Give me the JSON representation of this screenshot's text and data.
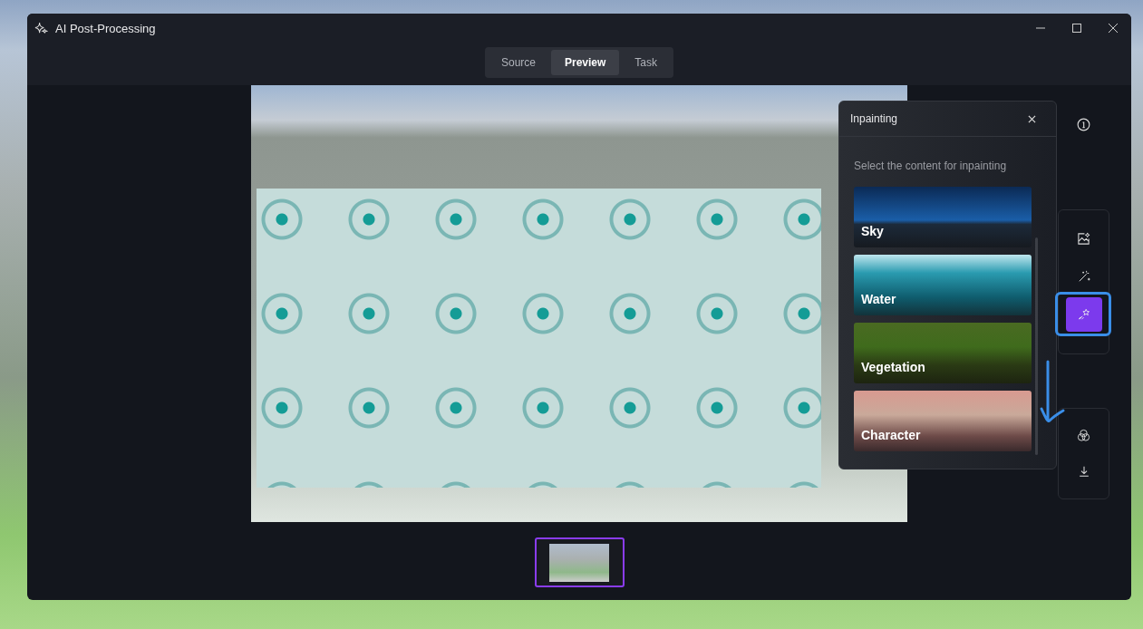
{
  "window": {
    "title": "AI Post-Processing"
  },
  "tabs": [
    {
      "label": "Source",
      "selected": false
    },
    {
      "label": "Preview",
      "selected": true
    },
    {
      "label": "Task",
      "selected": false
    }
  ],
  "inpainting_panel": {
    "title": "Inpainting",
    "instruction": "Select the content for inpainting",
    "options": [
      {
        "label": "Sky",
        "kind": "sky"
      },
      {
        "label": "Water",
        "kind": "water"
      },
      {
        "label": "Vegetation",
        "kind": "vegetation"
      },
      {
        "label": "Character",
        "kind": "character"
      }
    ]
  },
  "tool_groups": [
    [
      {
        "kind": "enhance",
        "selected": false
      },
      {
        "kind": "wand",
        "selected": false
      },
      {
        "kind": "inpaint",
        "selected": true
      }
    ],
    [
      {
        "kind": "color",
        "selected": false
      },
      {
        "kind": "download",
        "selected": false
      }
    ]
  ],
  "thumbnails": [
    {
      "selected": true
    }
  ]
}
